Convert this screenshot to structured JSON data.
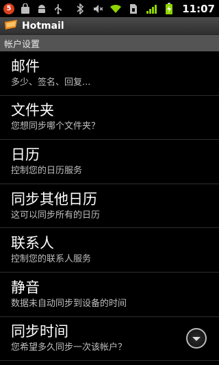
{
  "status_bar": {
    "notification_badge": "5",
    "time": "11:07"
  },
  "title_bar": {
    "app_title": "Hotmail"
  },
  "section": {
    "header": "帐户设置"
  },
  "settings": [
    {
      "title": "邮件",
      "summary": "多少、签名、回复..."
    },
    {
      "title": "文件夹",
      "summary": "您想同步哪个文件夹？"
    },
    {
      "title": "日历",
      "summary": "控制您的日历服务"
    },
    {
      "title": "同步其他日历",
      "summary": "这可以同步所有的日历"
    },
    {
      "title": "联系人",
      "summary": "控制您的联系人服务"
    },
    {
      "title": "静音",
      "summary": "数据未自动同步到设备的时间"
    },
    {
      "title": "同步时间",
      "summary": "您希望多久同步一次该帐户？"
    }
  ],
  "colors": {
    "battery": "#8fd400",
    "signal": "#8fd400",
    "wifi": "#8fd400",
    "badge": "#d9401e"
  }
}
